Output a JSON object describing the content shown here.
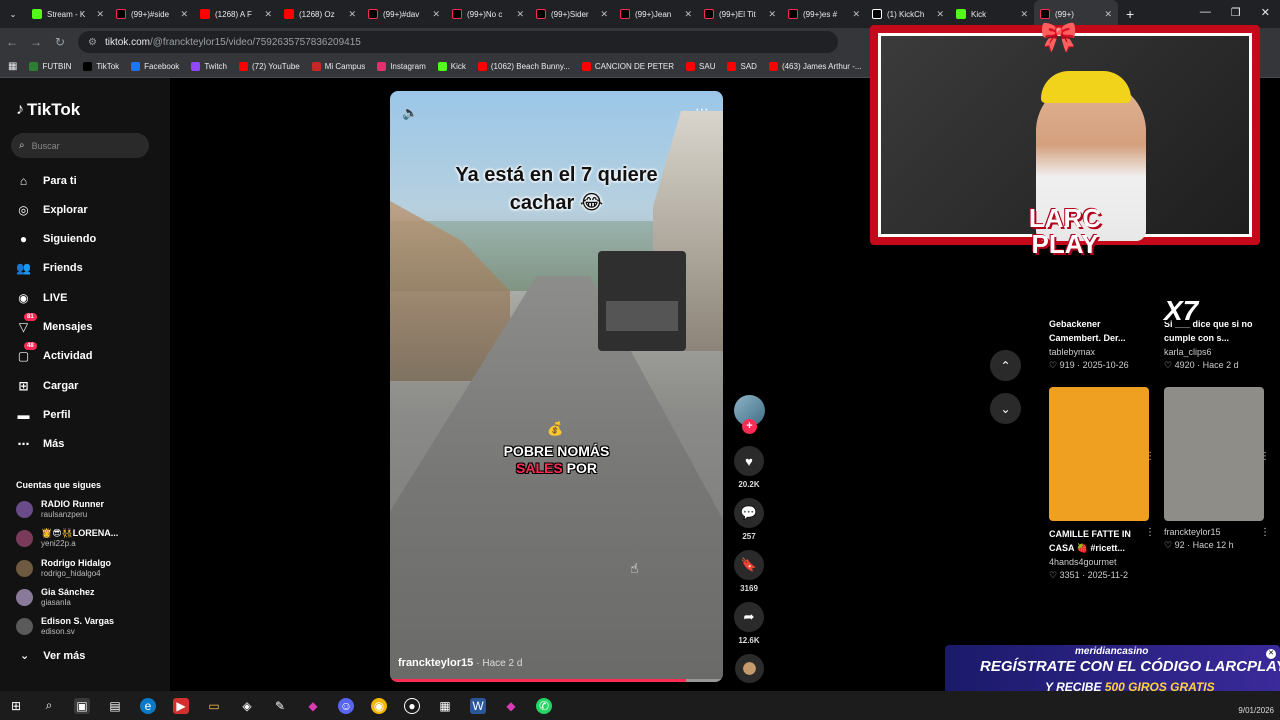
{
  "browser": {
    "tabs": [
      {
        "label": "Stream - K",
        "favicon": "kick-icon",
        "color": "#53fc18"
      },
      {
        "label": "(99+)#side",
        "favicon": "tiktok-icon"
      },
      {
        "label": "(1268) A F",
        "favicon": "youtube-icon"
      },
      {
        "label": "(1268) Oz",
        "favicon": "youtube-icon"
      },
      {
        "label": "(99+)#dav",
        "favicon": "tiktok-icon"
      },
      {
        "label": "(99+)No c",
        "favicon": "tiktok-icon"
      },
      {
        "label": "(99+)Sider",
        "favicon": "tiktok-icon"
      },
      {
        "label": "(99+)Jean",
        "favicon": "tiktok-icon"
      },
      {
        "label": "(99+)El Tit",
        "favicon": "tiktok-icon"
      },
      {
        "label": "(99+)es #",
        "favicon": "tiktok-icon"
      },
      {
        "label": "(1) KickCh",
        "favicon": "x-icon"
      },
      {
        "label": "Kick",
        "favicon": "kick-icon"
      },
      {
        "label": "(99+)",
        "favicon": "tiktok-icon",
        "active": true
      }
    ],
    "url_site": "tiktok.com",
    "url_path": "/@franckteylor15/video/7592635757836209415",
    "bookmarks": [
      {
        "label": "FUTBIN",
        "color": "#2e7d32"
      },
      {
        "label": "TikTok",
        "color": "#000000"
      },
      {
        "label": "Facebook",
        "color": "#1877f2"
      },
      {
        "label": "Twitch",
        "color": "#9146ff"
      },
      {
        "label": "(72) YouTube",
        "color": "#ff0000"
      },
      {
        "label": "Mi Campus",
        "color": "#c62828"
      },
      {
        "label": "Instagram",
        "color": "#e1306c"
      },
      {
        "label": "Kick",
        "color": "#53fc18"
      },
      {
        "label": "(1062) Beach Bunny...",
        "color": "#ff0000"
      },
      {
        "label": "CANCION DE PETER",
        "color": "#ff0000"
      },
      {
        "label": "SAU",
        "color": "#ff0000"
      },
      {
        "label": "SAD",
        "color": "#ff0000"
      },
      {
        "label": "(463) James Arthur -...",
        "color": "#ff0000"
      }
    ]
  },
  "sidebar": {
    "logo": "TikTok",
    "search_placeholder": "Buscar",
    "nav": [
      {
        "label": "Para ti",
        "icon": "home-icon"
      },
      {
        "label": "Explorar",
        "icon": "compass-icon"
      },
      {
        "label": "Siguiendo",
        "icon": "following-icon"
      },
      {
        "label": "Friends",
        "icon": "friends-icon"
      },
      {
        "label": "LIVE",
        "icon": "live-icon"
      },
      {
        "label": "Mensajes",
        "icon": "messages-icon",
        "badge": "81"
      },
      {
        "label": "Actividad",
        "icon": "activity-icon",
        "badge": "48"
      },
      {
        "label": "Cargar",
        "icon": "upload-icon"
      },
      {
        "label": "Perfil",
        "icon": "profile-icon"
      },
      {
        "label": "Más",
        "icon": "more-icon"
      }
    ],
    "following_title": "Cuentas que sigues",
    "accounts": [
      {
        "name": "RADIO Runner",
        "handle": "raulsanzperu"
      },
      {
        "name": "👸😎👯LORENA...",
        "handle": "yeni22p.a"
      },
      {
        "name": "Rodrigo Hidalgo",
        "handle": "rodrigo_hidalgo4"
      },
      {
        "name": "Gia Sánchez",
        "handle": "giasanla"
      },
      {
        "name": "Edison S. Vargas",
        "handle": "edison.sv"
      }
    ],
    "see_more": "Ver más"
  },
  "video": {
    "caption_line1": "Ya está en el 7 quiere",
    "caption_line2": "cachar 😂",
    "overlay_line1": "POBRE NOMÁS",
    "overlay_hl": "SALES",
    "overlay_rest": "POR",
    "author": "franckteylor15",
    "ago": "· Hace 2 d",
    "progress": 0.89
  },
  "actions": {
    "likes": "20.2K",
    "comments": "257",
    "saves": "3169",
    "shares": "12.6K"
  },
  "recommendations": [
    {
      "title": "Gebackener Camembert. Der...",
      "author": "tablebymax",
      "likes": "919",
      "date": "2025-10-26",
      "thumb": "#b4853a"
    },
    {
      "title": "Si ___ dice que si no cumple con s...",
      "author": "karla_clips6",
      "likes": "4920",
      "date": "Hace 2 d",
      "thumb": "#8a6c58"
    },
    {
      "title": "CAMILLE FATTE IN CASA 🍓 #ricett...",
      "author": "4hands4gourmet",
      "likes": "3351",
      "date": "2025-11-2",
      "thumb": "#f0a020"
    },
    {
      "title": "",
      "author": "franckteylor15",
      "likes": "92",
      "date": "Hace 12 h",
      "thumb": "#8f8d88"
    }
  ],
  "overlay": {
    "logo_line1": "LARC",
    "logo_line2": "PLAY",
    "x7": "X7",
    "banner_brand": "meridiancasino",
    "banner_line1_a": "REGÍSTRATE CON EL CÓDIGO",
    "banner_line1_b": "LARCPLAY",
    "banner_line2_a": "Y RECIBE",
    "banner_line2_b": "500 GIROS GRATIS"
  },
  "taskbar": {
    "date": "9/01/2026"
  }
}
